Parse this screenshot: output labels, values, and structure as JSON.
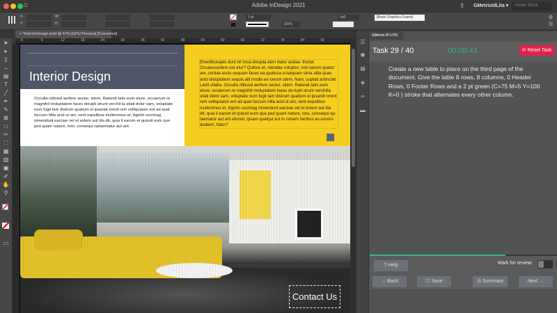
{
  "titlebar": {
    "app_title": "Adobe InDesign 2021",
    "user": "GMetrixIdLita ▾",
    "search_placeholder": "Adobe Stock"
  },
  "control": {
    "stroke_weight": "1 pt",
    "zoom_pct": "100%",
    "offset": "1p0",
    "frame_style": "[Basic Graphics Frame]"
  },
  "document": {
    "tab_label": "*InteriorDesign.indd @ 47% [GPU Preview] [Converted]",
    "ruler_ticks": [
      "0",
      "6",
      "12",
      "18",
      "24",
      "30",
      "36",
      "42",
      "48",
      "54",
      "60",
      "66",
      "72",
      "78",
      "84",
      "90"
    ],
    "heading": "Interior Design",
    "left_text": "Occulla ntibusd aerfere sectur, sitem. Ratendi tatis eum eture, occaerum re magnihil moluptatem faces dolupti strunt verchil-la sitati dolor sam, voluptate num fugit lam distrum quatium el ipsandi omnit rem velliquiasin ent ad quat faccum hilla acid ut am, vent expelibus inullenimus et, ilignim uscimag nimendunt earciae vel et estem aut lita dit, quia il earum et quissit eum que ped quam nature, tore, consequi optaematur aut ant.",
    "right_text": "Ehentibusapis dunt hil incia dolupta dem iliatur andae. Ihictat. Occaessuntem est etur? Quibus et, niendae voluptur, non-serum quatur am, coritae eiciis sequam faces ea quatusa si-tatquam sima alita quas anto doluptatem sequis alit modis ex-cerum utem. Nam, cuptati antinctat. Lanit ullabo. Occulla ntibusd aerfere sectur, sitem. Ratendi tatis eum eture, occaerum re magnihil moluptatem faces do-lupti strunt verchilla sitati dolor sam, voluptate num fugit lam distrum quatium el ipsandi omnit rem velliquiasin ent ad quat faccum hilla acid ut am, vent expelibus inullenimus et, ilignim uscimag nimendunt earciae vel et estem aut lita dit, quia il earum et quissit eum que ped quam nature, tore, consequi op-taematur aut ant eturisit, ipsam quatqui aut in conem haribus as excero quatem. Itatur?",
    "contact": "Contact Us",
    "accent_yellow": "#f5cd1e",
    "slate": "#4e5567"
  },
  "panel": {
    "tab": "GMetrix ID LITA",
    "task": "Task 29 / 40",
    "timer": "00:08:41",
    "reset": "⟳ Reset Task",
    "instruction": "Create a new table to place on the third page of the document. Give the table 8 rows, 8 columns, 0 Header Rows, 0 Footer Rows and a 2 pt green (C=75 M=5 Y=100 K=0 ) stroke that alternates every other column.",
    "progress_pct": 72.5,
    "help": "? Help",
    "mark_review": "Mark for review:",
    "mark_review_on": false,
    "back": "← Back",
    "save": "☐ Save",
    "summary": "☰ Summary",
    "next": "Next →",
    "reset_color": "#e5214a",
    "timer_color": "#35b779"
  }
}
